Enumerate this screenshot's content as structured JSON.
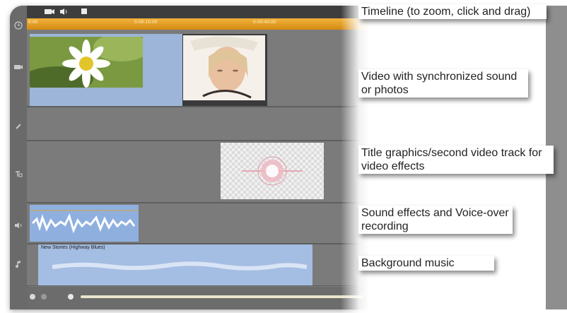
{
  "toolbar": {
    "icons": [
      "video-track-icon",
      "speaker-icon",
      "film-icon"
    ]
  },
  "ruler": {
    "tick_labels": [
      "0:00",
      "0:00:10.00",
      "0:00:40.00"
    ]
  },
  "tracks": [
    {
      "name": "video-track",
      "icon": "camera-icon"
    },
    {
      "name": "overlay-track",
      "icon": "pencil-icon"
    },
    {
      "name": "title-track",
      "icon": "title-icon"
    },
    {
      "name": "sound-effects-track",
      "icon": "speaker-icon"
    },
    {
      "name": "music-track",
      "icon": "music-note-icon"
    }
  ],
  "music_clip": {
    "label": "New Stories (Highway Blues)"
  },
  "callouts": {
    "timeline": "Timeline (to zoom, click and drag)",
    "video": "Video with synchronized sound or photos",
    "title": "Title graphics/second video track for video effects",
    "sound": "Sound effects and Voice-over recording",
    "music": "Background music"
  },
  "colors": {
    "ruler": "#e39a1f",
    "clip_blue": "#9db5d8",
    "track_gray": "#7b7b7b",
    "callout_bg": "#ffffff"
  }
}
